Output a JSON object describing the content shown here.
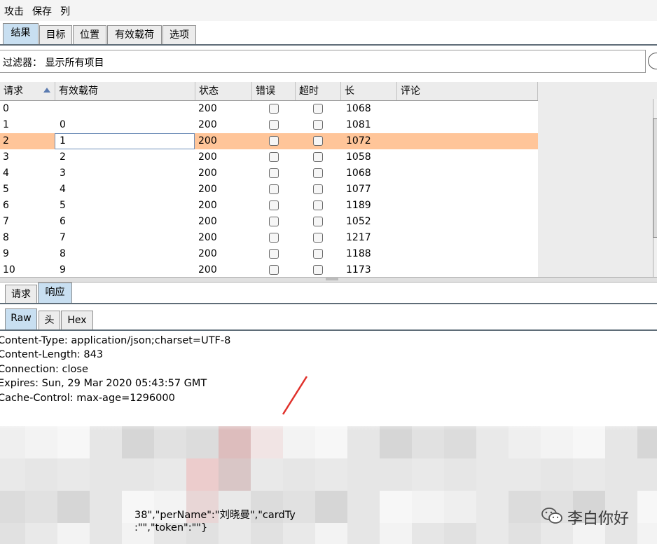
{
  "menu": [
    "攻击",
    "保存",
    "列"
  ],
  "main_tabs": [
    {
      "label": "结果",
      "active": true
    },
    {
      "label": "目标",
      "active": false
    },
    {
      "label": "位置",
      "active": false
    },
    {
      "label": "有效载荷",
      "active": false
    },
    {
      "label": "选项",
      "active": false
    }
  ],
  "filter": {
    "text": "过滤器：  显示所有项目"
  },
  "table": {
    "columns": [
      "请求",
      "有效载荷",
      "状态",
      "错误",
      "超时",
      "长",
      "评论"
    ],
    "sort_column": "请求",
    "rows": [
      {
        "req": "0",
        "payload": "",
        "status": "200",
        "error": false,
        "timeout": false,
        "length": "1068"
      },
      {
        "req": "1",
        "payload": "0",
        "status": "200",
        "error": false,
        "timeout": false,
        "length": "1081"
      },
      {
        "req": "2",
        "payload": "1",
        "status": "200",
        "error": false,
        "timeout": false,
        "length": "1072"
      },
      {
        "req": "3",
        "payload": "2",
        "status": "200",
        "error": false,
        "timeout": false,
        "length": "1058"
      },
      {
        "req": "4",
        "payload": "3",
        "status": "200",
        "error": false,
        "timeout": false,
        "length": "1068"
      },
      {
        "req": "5",
        "payload": "4",
        "status": "200",
        "error": false,
        "timeout": false,
        "length": "1077"
      },
      {
        "req": "6",
        "payload": "5",
        "status": "200",
        "error": false,
        "timeout": false,
        "length": "1189"
      },
      {
        "req": "7",
        "payload": "6",
        "status": "200",
        "error": false,
        "timeout": false,
        "length": "1052"
      },
      {
        "req": "8",
        "payload": "7",
        "status": "200",
        "error": false,
        "timeout": false,
        "length": "1217"
      },
      {
        "req": "9",
        "payload": "8",
        "status": "200",
        "error": false,
        "timeout": false,
        "length": "1188"
      },
      {
        "req": "10",
        "payload": "9",
        "status": "200",
        "error": false,
        "timeout": false,
        "length": "1173"
      }
    ],
    "selected_row": "2"
  },
  "detail_tabs": [
    {
      "label": "请求",
      "active": false
    },
    {
      "label": "响应",
      "active": true
    }
  ],
  "view_tabs": [
    {
      "label": "Raw",
      "active": true
    },
    {
      "label": "头",
      "active": false
    },
    {
      "label": "Hex",
      "active": false
    }
  ],
  "response": {
    "lines": [
      "Content-Type: application/json;charset=UTF-8",
      "Content-Length: 843",
      "Connection: close",
      "Expires: Sun, 29 Mar 2020 05:43:57 GMT",
      "Cache-Control: max-age=1296000"
    ],
    "partial_body_1": "38\",\"perName\":\"刘晓曼\",\"cardTy",
    "partial_body_2": ":\"\",\"token\":\"\"}"
  },
  "watermark": "李白你好",
  "colors": {
    "selected_row": "#ffc599",
    "active_tab": "#c8dff1",
    "arrow": "#e0302a"
  }
}
